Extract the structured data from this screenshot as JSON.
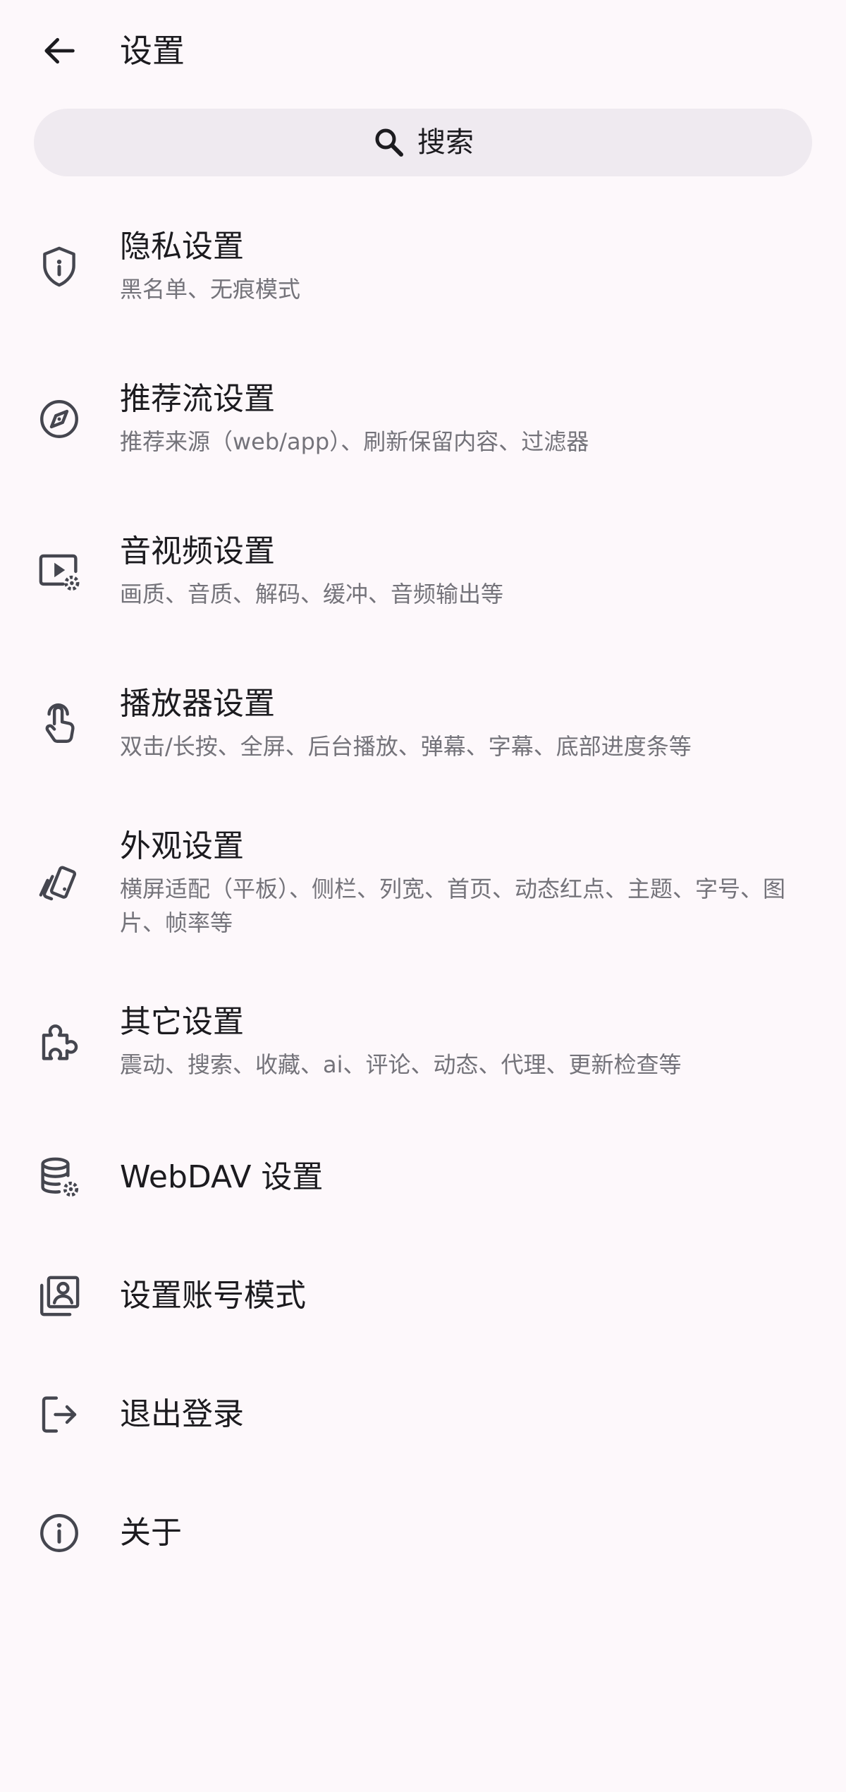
{
  "appbar": {
    "title": "设置"
  },
  "search": {
    "label": "搜索"
  },
  "items": [
    {
      "title": "隐私设置",
      "subtitle": "黑名单、无痕模式",
      "icon": "shield-icon"
    },
    {
      "title": "推荐流设置",
      "subtitle": "推荐来源（web/app）、刷新保留内容、过滤器",
      "icon": "compass-icon"
    },
    {
      "title": "音视频设置",
      "subtitle": "画质、音质、解码、缓冲、音频输出等",
      "icon": "video-settings-icon"
    },
    {
      "title": "播放器设置",
      "subtitle": "双击/长按、全屏、后台播放、弹幕、字幕、底部进度条等",
      "icon": "touch-icon"
    },
    {
      "title": "外观设置",
      "subtitle": "横屏适配（平板）、侧栏、列宽、首页、动态红点、主题、字号、图片、帧率等",
      "icon": "palette-cards-icon"
    },
    {
      "title": "其它设置",
      "subtitle": "震动、搜索、收藏、ai、评论、动态、代理、更新检查等",
      "icon": "puzzle-icon"
    },
    {
      "title": "WebDAV 设置",
      "icon": "database-settings-icon"
    },
    {
      "title": "设置账号模式",
      "icon": "account-box-icon"
    },
    {
      "title": "退出登录",
      "icon": "logout-icon"
    },
    {
      "title": "关于",
      "icon": "info-icon"
    }
  ]
}
